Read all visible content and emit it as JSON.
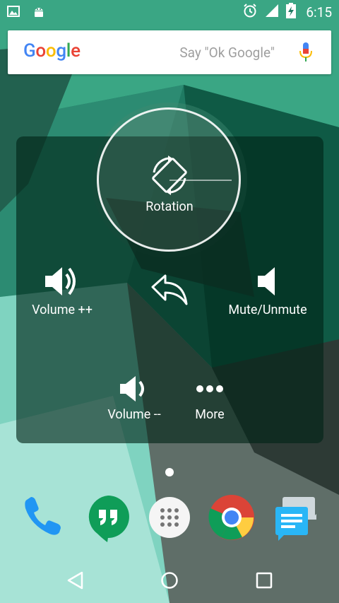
{
  "status_bar": {
    "time": "6:15",
    "icons": [
      "image-icon",
      "android-icon",
      "alarm-icon",
      "signal-icon",
      "battery-charging-icon"
    ]
  },
  "search_bar": {
    "logo": "Google",
    "hint": "Say \"Ok Google\"",
    "icon": "mic-icon"
  },
  "assistive_menu": {
    "rotation_label": "Rotation",
    "volume_up_label": "Volume ++",
    "back_icon": "back-arrow-icon",
    "mute_label": "Mute/Unmute",
    "volume_down_label": "Volume --",
    "more_label": "More"
  },
  "dock": {
    "apps": [
      "phone-icon",
      "hangouts-icon",
      "app-drawer-icon",
      "chrome-icon",
      "messenger-icon"
    ]
  },
  "nav": {
    "buttons": [
      "back-icon",
      "home-icon",
      "recents-icon"
    ]
  },
  "colors": {
    "panel_overlay": "rgba(0,35,22,0.62)",
    "google_blue": "#4285F4",
    "google_red": "#EA4335",
    "google_yellow": "#FBBC05",
    "google_green": "#34A853"
  }
}
